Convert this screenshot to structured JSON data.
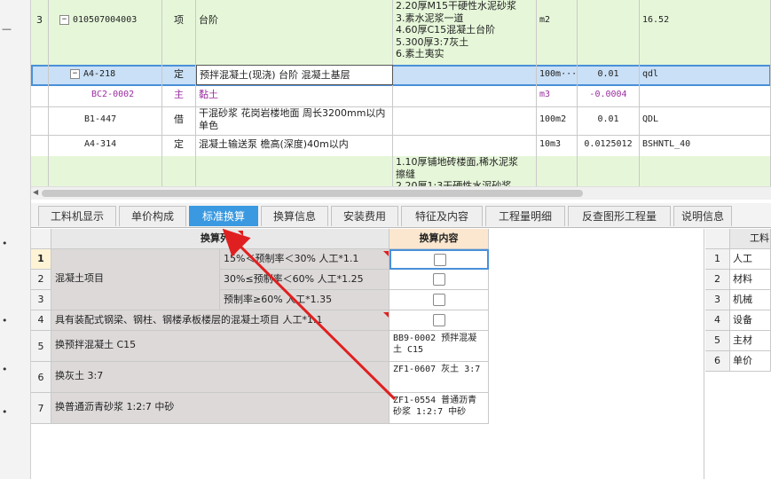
{
  "gutter_marks": [
    "—",
    "•",
    "•",
    "•",
    "•"
  ],
  "upper": {
    "rows": [
      {
        "num": "3",
        "code": "010507004003",
        "type": "项",
        "name": "台阶",
        "desc": "2.20厚M15干硬性水泥砂浆\n3.素水泥浆一道\n4.60厚C15混凝土台阶\n5.300厚3:7灰土\n6.素土夷实",
        "unit": "m2",
        "qty": "",
        "expr": "16.52"
      },
      {
        "num": "",
        "code": "A4-218",
        "type": "定",
        "name": "预拌混凝土(现浇) 台阶 混凝土基层",
        "desc": "",
        "unit": "100m···",
        "qty": "0.01",
        "expr": "qdl"
      },
      {
        "num": "",
        "code": "BC2-0002",
        "type": "主",
        "name": "黏土",
        "desc": "",
        "unit": "m3",
        "qty": "-0.0004",
        "expr": ""
      },
      {
        "num": "",
        "code": "B1-447",
        "type": "借",
        "name": "干混砂浆 花岗岩楼地面 周长3200mm以内 单色",
        "desc": "",
        "unit": "100m2",
        "qty": "0.01",
        "expr": "QDL"
      },
      {
        "num": "",
        "code": "A4-314",
        "type": "定",
        "name": "混凝土输送泵 檐高(深度)40m以内",
        "desc": "",
        "unit": "10m3",
        "qty": "0.0125012",
        "expr": "BSHNTL_40"
      },
      {
        "num": "",
        "code": "",
        "type": "",
        "name": "",
        "desc": "1.10厚铺地砖楼面,稀水泥浆\n擦缝\n2.20厚1:3干硬性水泥砂浆",
        "unit": "",
        "qty": "",
        "expr": ""
      }
    ]
  },
  "tabs": [
    "工料机显示",
    "单价构成",
    "标准换算",
    "换算信息",
    "安装费用",
    "特征及内容",
    "工程量明细",
    "反查图形工程量",
    "说明信息"
  ],
  "active_tab": "标准换算",
  "lower": {
    "header_list": "换算列表",
    "header_content": "换算内容",
    "group_label": "混凝土项目",
    "rows": [
      {
        "n": "1",
        "item": "15%＜预制率＜30% 人工*1.1",
        "content": ""
      },
      {
        "n": "2",
        "item": "30%≤预制率＜60% 人工*1.25",
        "content": ""
      },
      {
        "n": "3",
        "item": "预制率≥60% 人工*1.35",
        "content": ""
      },
      {
        "n": "4",
        "item": "具有装配式钢梁、钢柱、钢楼承板楼层的混凝土项目 人工*1.1",
        "content": ""
      },
      {
        "n": "5",
        "item": "换预拌混凝土 C15",
        "content": "BB9-0002  预拌混凝土 C15"
      },
      {
        "n": "6",
        "item": "换灰土 3:7",
        "content": "ZF1-0607  灰土 3:7"
      },
      {
        "n": "7",
        "item": "换普通沥青砂浆 1:2:7 中砂",
        "content": "ZF1-0554  普通沥青砂浆 1:2:7 中砂"
      }
    ]
  },
  "right_panel": {
    "header": "工料",
    "rows": [
      {
        "n": "1",
        "label": "人工"
      },
      {
        "n": "2",
        "label": "材料"
      },
      {
        "n": "3",
        "label": "机械"
      },
      {
        "n": "4",
        "label": "设备"
      },
      {
        "n": "5",
        "label": "主材"
      },
      {
        "n": "6",
        "label": "单价"
      }
    ]
  },
  "colors": {
    "accent": "#3a99e0",
    "arrow": "#e02020",
    "highlight_green": "#e6f7d9",
    "selected": "#c9e0f7",
    "purple_text": "#9b2ea0"
  }
}
